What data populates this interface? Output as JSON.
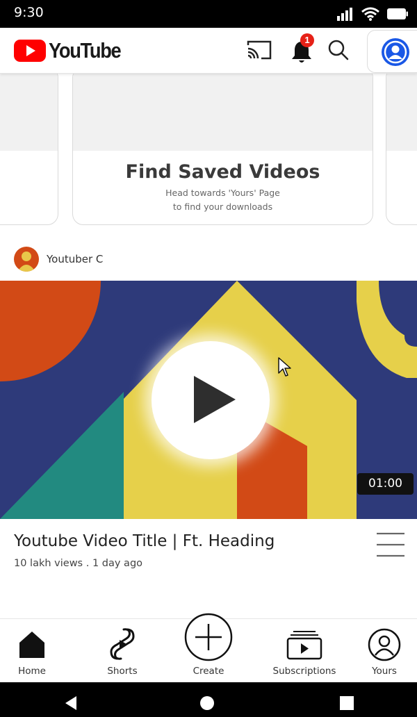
{
  "status_bar": {
    "time": "9:30",
    "icons": [
      "signal-icon",
      "wifi-icon",
      "battery-icon"
    ]
  },
  "app_bar": {
    "logo_text": "YouTube",
    "notification_count": "1",
    "icons": [
      "cast-icon",
      "bell-icon",
      "search-icon",
      "account-icon"
    ]
  },
  "carousel": {
    "card_title": "Find Saved Videos",
    "card_sub1": "Head towards 'Yours' Page",
    "card_sub2": "to find your downloads"
  },
  "video": {
    "channel_name": "Youtuber C",
    "duration": "01:00",
    "title": "Youtube Video Title | Ft. Heading",
    "meta": "10 lakh views . 1 day ago"
  },
  "bottom_nav": {
    "items": [
      {
        "label": "Home",
        "icon": "home-icon"
      },
      {
        "label": "Shorts",
        "icon": "shorts-icon"
      },
      {
        "label": "Create",
        "icon": "create-icon"
      },
      {
        "label": "Subscriptions",
        "icon": "subscriptions-icon"
      },
      {
        "label": "Yours",
        "icon": "yours-icon"
      }
    ]
  },
  "colors": {
    "brand_red": "#ff0000",
    "badge_red": "#e62117",
    "avatar_blue": "#1a58e6",
    "video_navy": "#2e3a7a",
    "video_yellow": "#e6d04a",
    "video_orange": "#d24a16",
    "video_teal": "#228a80"
  }
}
